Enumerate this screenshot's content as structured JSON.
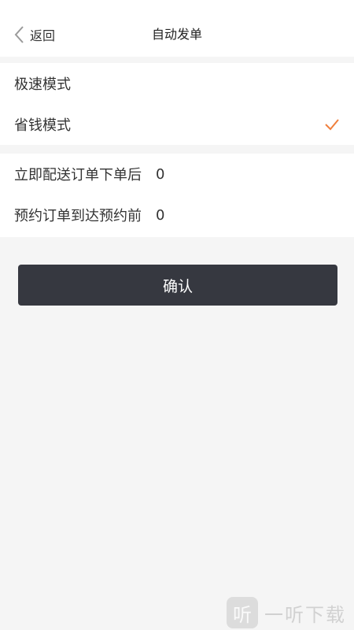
{
  "nav": {
    "back_label": "返回",
    "back_icon": "chevron-left-icon",
    "title": "自动发单"
  },
  "modes": [
    {
      "label": "极速模式",
      "selected": false
    },
    {
      "label": "省钱模式",
      "selected": true
    }
  ],
  "timings": [
    {
      "label": "立即配送订单下单后",
      "value": "0"
    },
    {
      "label": "预约订单到达预约前",
      "value": "0"
    }
  ],
  "confirm_label": "确认",
  "watermark": {
    "logo_char": "听",
    "text": "一听下载"
  },
  "colors": {
    "accent": "#f07f3c",
    "button": "#363840",
    "background": "#f5f5f5"
  }
}
